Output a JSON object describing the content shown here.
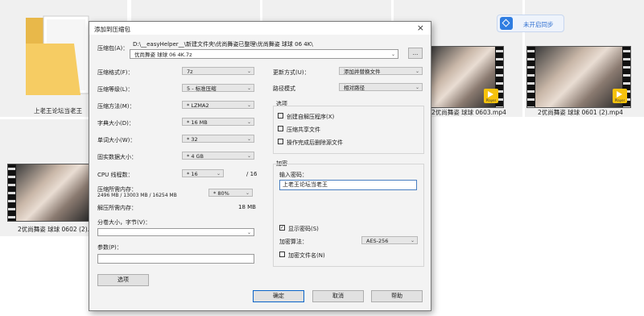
{
  "background_files": [
    {
      "caption": "上老王论坛当老王",
      "type": "folder"
    },
    {
      "caption": "2优尚舞姿 球球 0602 (2).mp4",
      "type": "video"
    },
    {
      "caption": "2优尚舞姿 球球 0603.mp4",
      "type": "video"
    },
    {
      "caption": "2优尚舞姿 球球 0601 (2).mp4",
      "type": "video"
    }
  ],
  "player_badge": "Player",
  "sync_badge": {
    "label": "未开启同步",
    "icon": "sync-icon",
    "color": "#2f7de1"
  },
  "dialog": {
    "title": "添加到压缩包",
    "close_glyph": "×",
    "archive_label": "压缩包(A)：",
    "archive_path": "D:\\__easyHelper__\\新建文件夹\\优尚舞姿已整理\\优尚舞姿 球球 06 4K\\",
    "archive_name": "优尚舞姿 球球 06 4K.7z",
    "browse_label": "...",
    "format_label": "压缩格式(F)：",
    "format_value": "7z",
    "level_label": "压缩等级(L)：",
    "level_value": "5 - 标准压缩",
    "method_label": "压缩方法(M)：",
    "method_value": "* LZMA2",
    "dict_label": "字典大小(D)：",
    "dict_value": "* 16 MB",
    "word_label": "单词大小(W)：",
    "word_value": "* 32",
    "solid_label": "固实数据大小：",
    "solid_value": "* 4 GB",
    "cpu_label": "CPU 线程数：",
    "cpu_value": "* 16",
    "cpu_total": "/ 16",
    "mem_comp_label": "压缩所需内存：",
    "mem_comp_detail": "2496 MB / 13003 MB / 16254 MB",
    "mem_comp_value": "* 80%",
    "mem_decomp_label": "解压所需内存：",
    "mem_decomp_value": "18 MB",
    "split_label": "分卷大小，字节(V)：",
    "split_value": "",
    "params_label": "参数(P)：",
    "params_value": "",
    "options_button": "选项",
    "update_label": "更新方式(U)：",
    "update_value": "添加并替换文件",
    "path_label": "路径模式",
    "path_value": "相对路径",
    "options_group": "选项",
    "opt_sfx": "创建自解压程序(X)",
    "opt_shared": "压缩共享文件",
    "opt_delete": "操作完成后删除源文件",
    "encrypt_group": "加密",
    "password_label": "输入密码：",
    "password_value": "上老王论坛当老王",
    "show_password": "显示密码(S)",
    "show_password_checked": true,
    "enc_method_label": "加密算法：",
    "enc_method_value": "AES-256",
    "enc_names": "加密文件名(N)",
    "ok_button": "确定",
    "cancel_button": "取消",
    "help_button": "帮助"
  }
}
